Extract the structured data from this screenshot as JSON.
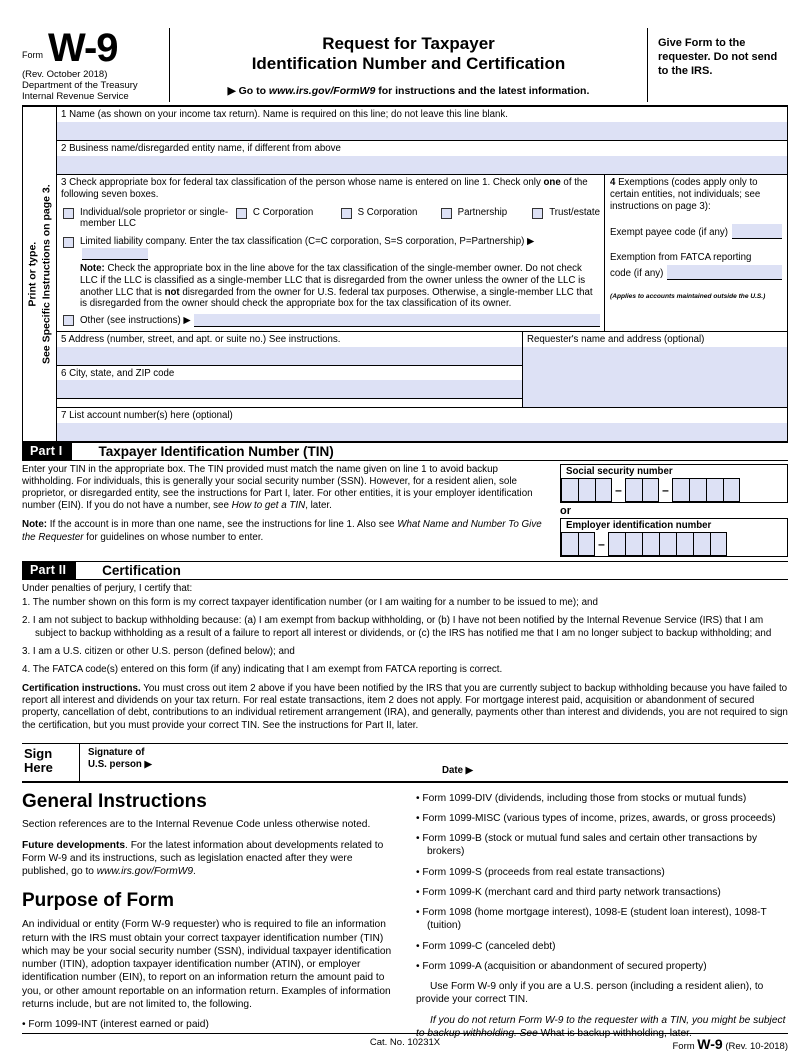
{
  "header": {
    "form_word": "Form",
    "form_number": "W-9",
    "revision": "(Rev. October 2018)",
    "department_line1": "Department of the Treasury",
    "department_line2": "Internal Revenue Service",
    "title_line1": "Request for Taxpayer",
    "title_line2": "Identification Number and Certification",
    "goto_prefix": "▶ Go to ",
    "goto_url": "www.irs.gov/FormW9",
    "goto_suffix": " for instructions and the latest information.",
    "give_form_note": "Give Form to the requester. Do not send to the IRS."
  },
  "sidebar": {
    "line1": "Print or type.",
    "line2": "See Specific Instructions on page 3."
  },
  "fields": {
    "line1_label": "1  Name (as shown on your income tax return). Name is required on this line; do not leave this line blank.",
    "line2_label": "2  Business name/disregarded entity name, if different from above",
    "line3_label_a": "3  Check appropriate box for federal tax classification of the person whose name is entered on line 1. Check only ",
    "line3_label_b": "one",
    "line3_label_c": " of the following seven boxes.",
    "checkboxes": [
      {
        "label": "Individual/sole proprietor or single-member LLC"
      },
      {
        "label": "C Corporation"
      },
      {
        "label": "S Corporation"
      },
      {
        "label": "Partnership"
      },
      {
        "label": "Trust/estate"
      }
    ],
    "llc_label": "Limited liability company. Enter the tax classification (C=C corporation, S=S corporation, P=Partnership) ▶",
    "llc_note_bold": "Note:",
    "llc_note_a": " Check the appropriate box in the line above for the tax classification of the single-member owner.  Do not check LLC if the LLC is classified as a single-member LLC that is disregarded from the owner unless the owner of the LLC is another LLC that is ",
    "llc_note_bold2": "not",
    "llc_note_b": " disregarded from the owner for U.S. federal tax purposes. Otherwise, a single-member LLC that is disregarded from the owner should check the appropriate box for the tax classification of its owner.",
    "other_label": "Other (see instructions) ▶",
    "line4_num": "4",
    "line4_label": "  Exemptions (codes apply only to certain entities, not individuals; see instructions on page 3):",
    "exempt_payee_label": "Exempt payee code (if any)",
    "fatca_label_line1": "Exemption from FATCA reporting",
    "fatca_label_line2": "code (if any)",
    "applies_note": "(Applies to accounts maintained outside the U.S.)",
    "line5_label": "5  Address (number, street, and apt. or suite no.) See instructions.",
    "line6_label": "6  City, state, and ZIP code",
    "line7_label": "7  List account number(s) here (optional)",
    "requester_label": "Requester's name and address (optional)"
  },
  "part1": {
    "tag": "Part I",
    "title": "Taxpayer Identification Number (TIN)",
    "para1": "Enter your TIN in the appropriate box. The TIN provided must match the name given on line 1 to avoid backup withholding. For individuals, this is generally your social security number (SSN). However, for a resident alien, sole proprietor, or disregarded entity, see the instructions for Part I, later. For other entities, it is your employer identification number (EIN). If you do not have a number, see ",
    "para1_italic": "How to get a TIN",
    "para1_end": ", later.",
    "note_bold": "Note:",
    "note_a": " If the account is in more than one name, see the instructions for line 1. Also see ",
    "note_italic": "What Name and Number To Give the Requester",
    "note_b": " for guidelines on whose number to enter.",
    "ssn_label": "Social security number",
    "ein_label": "Employer identification number",
    "or_word": "or",
    "dash": "–"
  },
  "part2": {
    "tag": "Part II",
    "title": "Certification",
    "intro": "Under penalties of perjury, I certify that:",
    "items": [
      "1. The number shown on this form is my correct taxpayer identification number (or I am waiting for a number to be issued to me); and",
      "2. I am not subject to backup withholding because: (a) I am exempt from backup withholding, or (b) I have not been notified by the Internal Revenue Service (IRS) that I am subject to backup withholding as a result of a failure to report all interest or dividends, or (c) the IRS has notified me that I am no longer subject to backup withholding; and",
      "3. I am a U.S. citizen or other U.S. person (defined below); and",
      "4. The FATCA code(s) entered on this form (if any) indicating that I am exempt from FATCA reporting is correct."
    ],
    "cert_bold": "Certification instructions.",
    "cert_text": " You must cross out item 2 above if you have been notified by the IRS that you are currently subject to backup withholding because you have failed to report all interest and dividends on your tax return. For real estate transactions, item 2 does not apply. For mortgage interest paid, acquisition or abandonment of secured property, cancellation of debt, contributions to an individual retirement arrangement (IRA), and generally, payments other than interest and dividends, you are not required to sign the certification, but you must provide your correct TIN. See the instructions for Part II, later.",
    "sign_here_line1": "Sign",
    "sign_here_line2": "Here",
    "signature_line1": "Signature of",
    "signature_line2": "U.S. person ▶",
    "date_label": "Date ▶"
  },
  "instructions": {
    "general_heading": "General Instructions",
    "section_ref": "Section references are to the Internal Revenue Code unless otherwise noted.",
    "future_bold": "Future developments",
    "future_text": ". For the latest information about developments related to Form W-9 and its instructions, such as legislation enacted after they were published, go to ",
    "future_url": "www.irs.gov/FormW9",
    "future_end": ".",
    "purpose_heading": "Purpose of Form",
    "purpose_text": "An individual or entity (Form W-9 requester) who is required to file an information return with the IRS must obtain your correct taxpayer identification number (TIN) which may be your social security number (SSN), individual taxpayer identification number (ITIN), adoption taxpayer identification number (ATIN), or employer identification number (EIN), to report on an information return the amount paid to you, or other amount reportable on an information return. Examples of information returns include, but are not limited to, the following.",
    "bullets_left": [
      "• Form 1099-INT (interest earned or paid)"
    ],
    "bullets_right": [
      "• Form 1099-DIV (dividends, including those from stocks or mutual funds)",
      "• Form 1099-MISC (various types of income, prizes, awards, or gross proceeds)",
      "• Form 1099-B (stock or mutual fund sales and certain other transactions by brokers)",
      "• Form 1099-S (proceeds from real estate transactions)",
      "• Form 1099-K (merchant card and third party network transactions)",
      "• Form 1098 (home mortgage interest), 1098-E (student loan interest), 1098-T (tuition)",
      "• Form 1099-C (canceled debt)",
      "• Form 1099-A (acquisition or abandonment of secured property)"
    ],
    "use_w9_text": "Use Form W-9 only if you are a U.S. person (including a resident alien), to provide your correct TIN.",
    "no_return_italic": "If you do not return Form W-9 to the requester with a TIN, you might be subject to backup withholding. See",
    "no_return_rest": " What is backup withholding, later."
  },
  "footer": {
    "cat_no": "Cat. No. 10231X",
    "form_word": "Form ",
    "form_number": "W-9",
    "revision": " (Rev. 10-2018)"
  },
  "colors": {
    "field_fill": "#dde1f5",
    "rule": "#000000",
    "page_bg": "#ffffff"
  }
}
